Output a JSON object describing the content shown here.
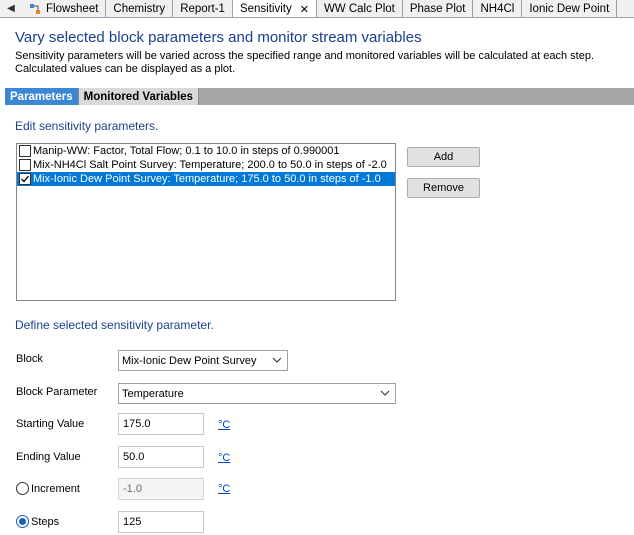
{
  "tabs": [
    {
      "label": "Flowsheet",
      "active": false,
      "icon": "flowsheet-icon"
    },
    {
      "label": "Chemistry",
      "active": false,
      "icon": ""
    },
    {
      "label": "Report-1",
      "active": false,
      "icon": ""
    },
    {
      "label": "Sensitivity",
      "active": true,
      "icon": ""
    },
    {
      "label": "WW Calc Plot",
      "active": false,
      "icon": ""
    },
    {
      "label": "Phase Plot",
      "active": false,
      "icon": ""
    },
    {
      "label": "NH4Cl",
      "active": false,
      "icon": ""
    },
    {
      "label": "Ionic Dew Point",
      "active": false,
      "icon": ""
    }
  ],
  "tab_close_glyph": "✕",
  "header": {
    "title": "Vary selected block parameters and monitor stream variables",
    "description_line1": "Sensitivity parameters will be varied across the specified range and monitored variables will be calculated at each step.",
    "description_line2": "Calculated values can be displayed as a plot."
  },
  "subtabs": {
    "parameters": "Parameters",
    "monitored": "Monitored Variables"
  },
  "edit_section": {
    "label": "Edit sensitivity parameters.",
    "items": [
      {
        "text": "Manip-WW: Factor, Total Flow; 0.1 to 10.0 in steps of 0.990001",
        "checked": false,
        "selected": false
      },
      {
        "text": "Mix-NH4Cl Salt Point Survey: Temperature; 200.0 to 50.0 in steps of -2.0",
        "checked": false,
        "selected": false
      },
      {
        "text": "Mix-Ionic Dew Point Survey: Temperature; 175.0 to 50.0 in steps of -1.0",
        "checked": true,
        "selected": true
      }
    ],
    "add_label": "Add",
    "remove_label": "Remove"
  },
  "define_section": {
    "label": "Define selected sensitivity parameter.",
    "block_label": "Block",
    "block_value": "Mix-Ionic Dew Point Survey",
    "param_label": "Block Parameter",
    "param_value": "Temperature",
    "start_label": "Starting Value",
    "start_value": "175.0",
    "end_label": "Ending Value",
    "end_value": "50.0",
    "increment_label": "Increment",
    "increment_value": "-1.0",
    "steps_label": "Steps",
    "steps_value": "125",
    "unit": "°C",
    "selected_mode": "steps"
  },
  "colors": {
    "accent": "#3c87d4",
    "title": "#1b3f8f",
    "selection": "#0078d7"
  }
}
